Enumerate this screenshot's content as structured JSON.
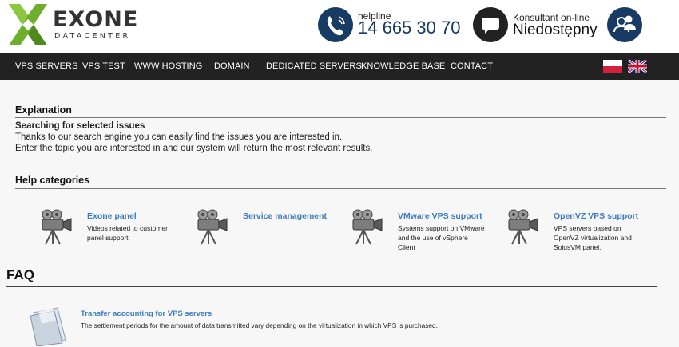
{
  "header": {
    "logo_text": "EXONE",
    "logo_sub": "DATACENTER",
    "helpline_label": "helpline",
    "helpline_number": "14 665 30 70",
    "chat_label": "Konsultant on-line",
    "chat_status": "Niedostępny",
    "icons": [
      "phone-icon",
      "chat-icon",
      "users-icon"
    ]
  },
  "nav": {
    "items": [
      {
        "label": "VPS SERVERS"
      },
      {
        "label": "VPS TEST"
      },
      {
        "label": "WWW HOSTING"
      },
      {
        "label": "DOMAIN"
      },
      {
        "label": "DEDICATED SERVERS"
      },
      {
        "label": "KNOWLEDGE BASE"
      },
      {
        "label": "CONTACT"
      }
    ],
    "languages": [
      "polish-flag-icon",
      "uk-flag-icon"
    ]
  },
  "explanation": {
    "title": "Explanation",
    "subtitle": "Searching for selected issues",
    "line1": "Thanks to our search engine you can easily find the issues you are interested in.",
    "line2": "Enter the topic you are interested in and our system will return the most relevant results."
  },
  "categories": {
    "title": "Help categories",
    "items": [
      {
        "title": "Exone panel",
        "description": "Videos related to customer panel support."
      },
      {
        "title": "Service management",
        "description": ""
      },
      {
        "title": "VMware VPS support",
        "description": "Systems support on VMware and the use of vSphere Client"
      },
      {
        "title": "OpenVZ VPS support",
        "description": "VPS servers based on OpenVZ virtualization and SolusVM panel."
      }
    ]
  },
  "faq": {
    "title": "FAQ",
    "items": [
      {
        "title": "Transfer accounting for VPS servers",
        "description": "The settlement periods for the amount of data transmitted vary depending on the virtualization in which VPS is purchased."
      }
    ]
  },
  "colors": {
    "nav_bg": "#222222",
    "brand_blue": "#173b63",
    "link_blue": "#3b7cc0",
    "logo_green": "#7ab32e"
  }
}
